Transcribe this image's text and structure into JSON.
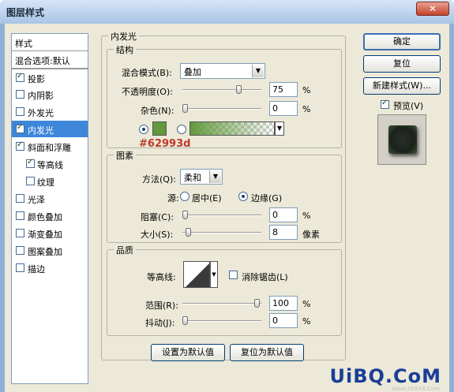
{
  "window": {
    "title": "图层样式",
    "close_glyph": "✕"
  },
  "style_list": {
    "header": "样式",
    "blend_options": "混合选项:默认",
    "items": [
      {
        "label": "投影",
        "checked": true
      },
      {
        "label": "内阴影",
        "checked": false
      },
      {
        "label": "外发光",
        "checked": false
      },
      {
        "label": "内发光",
        "checked": true,
        "selected": true
      },
      {
        "label": "斜面和浮雕",
        "checked": true
      },
      {
        "label": "等高线",
        "checked": true,
        "sub": true
      },
      {
        "label": "纹理",
        "checked": false,
        "sub": true
      },
      {
        "label": "光泽",
        "checked": false
      },
      {
        "label": "颜色叠加",
        "checked": false
      },
      {
        "label": "渐变叠加",
        "checked": false
      },
      {
        "label": "图案叠加",
        "checked": false
      },
      {
        "label": "描边",
        "checked": false
      }
    ]
  },
  "inner_glow": {
    "title": "内发光",
    "structure": {
      "title": "结构",
      "blend_mode_label": "混合模式(B):",
      "blend_mode_value": "叠加",
      "opacity_label": "不透明度(O):",
      "opacity_value": "75",
      "opacity_percent": 0.75,
      "noise_label": "杂色(N):",
      "noise_value": "0",
      "noise_percent": 0,
      "unit": "%",
      "color_hex_label": "#62993d",
      "glow_color": "#62993d"
    },
    "elements": {
      "title": "图素",
      "technique_label": "方法(Q):",
      "technique_value": "柔和",
      "source_label": "源:",
      "source_center": "居中(E)",
      "source_edge": "边缘(G)",
      "choke_label": "阻塞(C):",
      "choke_value": "0",
      "choke_percent": 0,
      "size_label": "大小(S):",
      "size_value": "8",
      "size_unit": "像素",
      "unit": "%"
    },
    "quality": {
      "title": "品质",
      "contour_label": "等高线:",
      "antialias_label": "消除锯齿(L)",
      "range_label": "范围(R):",
      "range_value": "100",
      "range_percent": 1.0,
      "jitter_label": "抖动(J):",
      "jitter_value": "0",
      "jitter_percent": 0,
      "unit": "%"
    },
    "make_default": "设置为默认值",
    "reset_default": "复位为默认值"
  },
  "buttons": {
    "ok": "确定",
    "reset": "复位",
    "new_style": "新建样式(W)...",
    "preview_label": "预览(V)"
  },
  "watermark": {
    "main": "UiBQ.CoM",
    "sub": "Www.16XX8.Com"
  }
}
